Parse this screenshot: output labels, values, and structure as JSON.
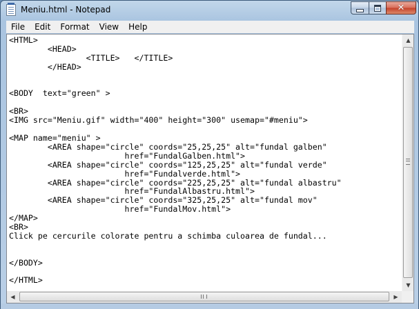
{
  "window": {
    "title": "Meniu.html - Notepad",
    "app_icon": "notepad-icon",
    "controls": {
      "minimize": "minimize-icon",
      "maximize": "maximize-icon",
      "close": "close-icon"
    }
  },
  "menu": {
    "items": [
      {
        "label": "File"
      },
      {
        "label": "Edit"
      },
      {
        "label": "Format"
      },
      {
        "label": "View"
      },
      {
        "label": "Help"
      }
    ]
  },
  "editor": {
    "text": "<HTML>\n        <HEAD>\n                <TITLE>   </TITLE>\n        </HEAD>\n\n\n<BODY  text=\"green\" >\n\n<BR>\n<IMG src=\"Meniu.gif\" width=\"400\" height=\"300\" usemap=\"#meniu\">\n\n<MAP name=\"meniu\" >\n        <AREA shape=\"circle\" coords=\"25,25,25\" alt=\"fundal galben\"\n                        href=\"FundalGalben.html\">\n        <AREA shape=\"circle\" coords=\"125,25,25\" alt=\"fundal verde\"\n                        href=\"Fundalverde.html\">\n        <AREA shape=\"circle\" coords=\"225,25,25\" alt=\"fundal albastru\"\n                        href=\"FundalAlbastru.html\">\n        <AREA shape=\"circle\" coords=\"325,25,25\" alt=\"fundal mov\"\n                        href=\"FundalMov.html\">\n</MAP>\n<BR>\nClick pe cercurile colorate pentru a schimba culoarea de fundal...\n\n\n</BODY>\n\n</HTML>"
  },
  "scrollbars": {
    "vertical": {
      "up_icon": "arrow-up-icon",
      "down_icon": "arrow-down-icon"
    },
    "horizontal": {
      "left_icon": "arrow-left-icon",
      "right_icon": "arrow-right-icon"
    }
  },
  "colors": {
    "title_bar": "#b9cfe6",
    "close_button": "#c4412a",
    "editor_background": "#ffffff",
    "text": "#000000"
  }
}
